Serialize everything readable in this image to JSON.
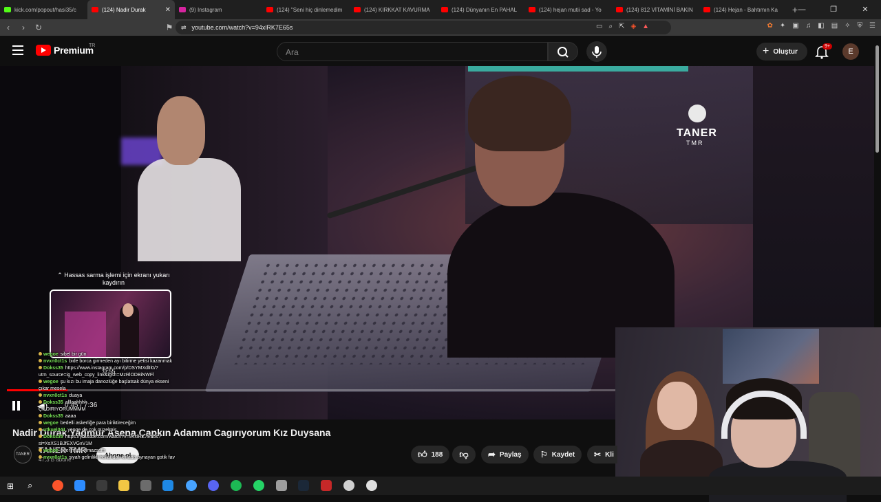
{
  "browser": {
    "tabs": [
      {
        "title": "kick.com/popout/hasi35/c",
        "color": "#53fc18"
      },
      {
        "title": "(124) Nadir Durak",
        "color": "#ff0000",
        "active": true
      },
      {
        "title": "(9) Instagram",
        "color": "#d6249f"
      },
      {
        "title": "(124) \"Seni hiç dinlemedim",
        "color": "#ff0000"
      },
      {
        "title": "(124) KIRKKAT KAVURMA",
        "color": "#ff0000"
      },
      {
        "title": "(124) Dünyanın En PAHAL",
        "color": "#ff0000"
      },
      {
        "title": "(124) hejan mutii sad - Yo",
        "color": "#ff0000"
      },
      {
        "title": "(124) 812 VİTAMİNİ BAKIN",
        "color": "#ff0000"
      },
      {
        "title": "(124) Hejan - Bahtımın Ka",
        "color": "#ff0000"
      }
    ],
    "url": "youtube.com/watch?v=94xlRK7E65s"
  },
  "masthead": {
    "brand": "Premium",
    "region": "TR",
    "search_placeholder": "Ara",
    "create_label": "Oluştur",
    "notif_badge": "9+",
    "avatar_initial": "E"
  },
  "video": {
    "watermark_line1": "TANER",
    "watermark_line2": "TMR",
    "hint": "⌃ Hassas sarma işlemi için ekranı yukarı kaydırın",
    "preview_time": "0:55",
    "timecode": "0:45 / 7:36",
    "progress": 0.1
  },
  "meta": {
    "title": "Nadir Durak Yağmur Asena Çapkın Adamım Cagırıyorum Kız Duysana",
    "channel": "TANER TMR",
    "channel_avatar": "TANER",
    "subscribers": "47,3 B abone",
    "subscribe_label": "Abone ol",
    "likes": "188",
    "share_label": "Paylaş",
    "save_label": "Kaydet",
    "clip_label": "Kli"
  },
  "chat": [
    {
      "user": "wegoe",
      "text": "sibel bir gün"
    },
    {
      "user": "nvxn0ct1s",
      "text": "bide borca girmeden ayı bitirme yetisi kazanmak"
    },
    {
      "user": "Dokss35",
      "text": "https://www.instagram.com/p/DSYMXdlIl0/?"
    },
    {
      "user": "",
      "text": "utm_source=ig_web_copy_link&igsh=MzRlODBiNWFl"
    },
    {
      "user": "wegoe",
      "text": "şu kızı bu imaja danozlüğe başlatsak dünya ekseni"
    },
    {
      "user": "",
      "text": "çıkar mesela"
    },
    {
      "user": "nvxn0ct1s",
      "text": "duaya"
    },
    {
      "user": "Dokss35",
      "text": "alllaahhhh"
    },
    {
      "user": "",
      "text": "ÇILDIRIYORUMMMM"
    },
    {
      "user": "Dokss35",
      "text": "aaaa"
    },
    {
      "user": "wegoe",
      "text": "bedelli askerliğe para biriktireceğim"
    },
    {
      "user": "utkuel041",
      "text": "yenge de çok güzelmiş"
    },
    {
      "user": "Dokss35",
      "text": "https://youtube.com/watch?v=94xlRK7E65s?"
    },
    {
      "user": "",
      "text": "si=XsXS1BJfEXVGxV1M"
    },
    {
      "user": "wegoe",
      "text": "eğer must olmazsam"
    },
    {
      "user": "nvxn0ct1s",
      "text": "siyah gelinlikli hollandalı kinada oynayan gotik fav"
    }
  ]
}
